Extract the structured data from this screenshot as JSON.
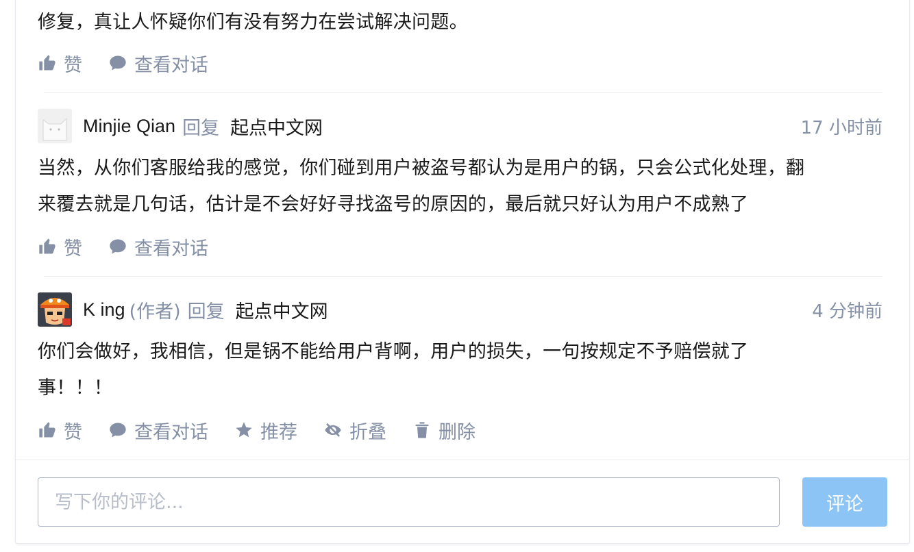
{
  "comments": [
    {
      "body": "修复，真让人怀疑你们有没有努力在尝试解决问题。",
      "actions": [
        {
          "icon": "thumbs-up-icon",
          "label": "赞"
        },
        {
          "icon": "chat-bubble-icon",
          "label": "查看对话"
        }
      ]
    },
    {
      "author": "Minjie Qian",
      "reply_word": "回复",
      "reply_to": "起点中文网",
      "time": "17 小时前",
      "avatar": "cat-avatar-icon",
      "body_lines": [
        "当然，从你们客服给我的感觉，你们碰到用户被盗号都认为是用户的锅，只会公式化处理，翻",
        "来覆去就是几句话，估计是不会好好寻找盗号的原因的，最后就只好认为用户不成熟了"
      ],
      "actions": [
        {
          "icon": "thumbs-up-icon",
          "label": "赞"
        },
        {
          "icon": "chat-bubble-icon",
          "label": "查看对话"
        }
      ]
    },
    {
      "author": "K ing",
      "author_tag": "(作者)",
      "reply_word": "回复",
      "reply_to": "起点中文网",
      "time": "4 分钟前",
      "avatar": "cartoon-avatar-icon",
      "body_lines": [
        "你们会做好，我相信，但是锅不能给用户背啊，用户的损失，一句按规定不予赔偿就了",
        "事！！！"
      ],
      "actions": [
        {
          "icon": "thumbs-up-icon",
          "label": "赞"
        },
        {
          "icon": "chat-bubble-icon",
          "label": "查看对话"
        },
        {
          "icon": "star-icon",
          "label": "推荐"
        },
        {
          "icon": "eye-slash-icon",
          "label": "折叠"
        },
        {
          "icon": "trash-icon",
          "label": "删除"
        }
      ]
    }
  ],
  "composer": {
    "placeholder": "写下你的评论...",
    "submit_label": "评论"
  },
  "colors": {
    "meta_gray": "#8590a6",
    "submit_disabled_blue": "#8cc4f5",
    "input_border": "#aab4c6"
  }
}
